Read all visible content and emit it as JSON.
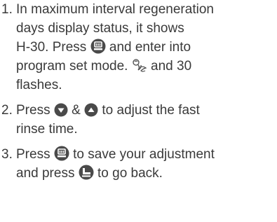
{
  "steps": [
    {
      "number": "1.",
      "line1": "In maximum interval regeneration",
      "line2": "days display status, it shows",
      "line3_text_a": "H-30. Press ",
      "line3_text_b": " and enter into",
      "line4_text_a": "program set mode. ",
      "line4_text_b": " and 30",
      "line5": "flashes.",
      "icons": [
        "menu-button-icon",
        "wrench-flush-icon"
      ]
    },
    {
      "number": "2.",
      "line1_text_a": "Press ",
      "line1_text_b": " & ",
      "line1_text_c": " to adjust the fast",
      "line2": "rinse time.",
      "icons": [
        "down-arrow-button-icon",
        "up-arrow-button-icon"
      ]
    },
    {
      "number": "3.",
      "line1_text_a": "Press ",
      "line1_text_b": " to save your adjustment",
      "line2_text_a": "and press ",
      "line2_text_b": " to go back.",
      "icons": [
        "menu-button-icon",
        "back-button-icon"
      ]
    }
  ],
  "colors": {
    "text": "#3a3a3a",
    "icon": "#4a4a4a"
  }
}
